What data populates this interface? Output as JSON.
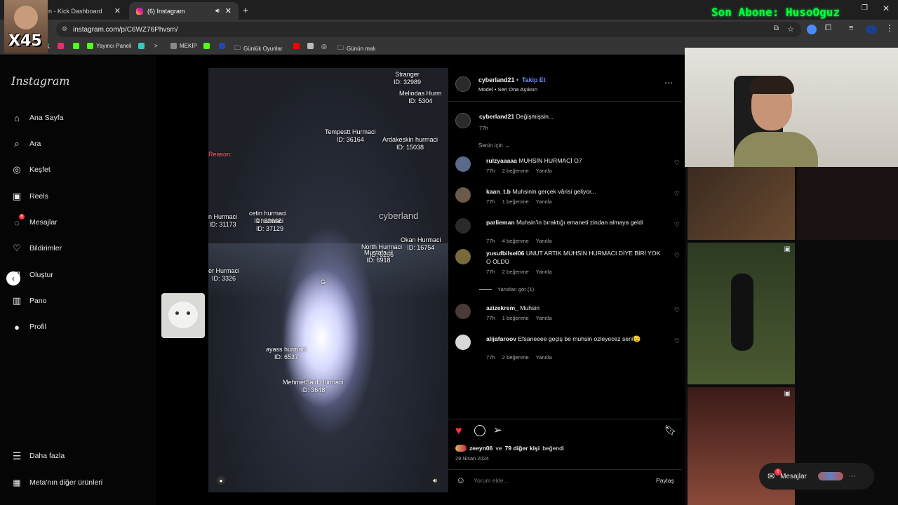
{
  "browser": {
    "tabs": [
      {
        "title": "n - Kick Dashboard"
      },
      {
        "title": "(6) Instagram"
      }
    ],
    "new_tab": "+",
    "url": "instagram.com/p/C6WZ76Phvsm/",
    "bookmarks": [
      "Yayıncı Paneli",
      "MEKİP",
      "Günlük Oyunlar",
      "Günün malı"
    ]
  },
  "stream_overlay": {
    "badge": "X45",
    "subscriber_banner": "Son Abone: HusoOguz"
  },
  "instagram": {
    "logo": "Instagram",
    "nav": [
      {
        "label": "Ana Sayfa",
        "icon": "home-icon"
      },
      {
        "label": "Ara",
        "icon": "search-icon"
      },
      {
        "label": "Keşfet",
        "icon": "explore-icon"
      },
      {
        "label": "Reels",
        "icon": "reels-icon"
      },
      {
        "label": "Mesajlar",
        "icon": "messages-icon",
        "badge": "6"
      },
      {
        "label": "Bildirimler",
        "icon": "heart-icon"
      },
      {
        "label": "Oluştur",
        "icon": "create-icon"
      },
      {
        "label": "Pano",
        "icon": "dashboard-icon"
      },
      {
        "label": "Profil",
        "icon": "profile-icon"
      }
    ],
    "more": "Daha fazla",
    "meta": "Meta'nın diğer ürünleri"
  },
  "post": {
    "author": "cyberland21",
    "follow": "Takip Et",
    "subtitle": "Model • Sen Ona Aşıksın",
    "caption_author": "cyberland21",
    "caption": "Değişmişsin...",
    "caption_time": "77h",
    "sort_label": "Senin için",
    "comments": [
      {
        "user": "rulzyaaaaa",
        "text": "MUHSİN HURMACİ O7",
        "time": "77h",
        "likes": "2 beğenme",
        "reply": "Yanıtla"
      },
      {
        "user": "kaan_t.b",
        "text": "Muhsinin gerçek vârisi geliyor...",
        "time": "77h",
        "likes": "1 beğenme",
        "reply": "Yanıtla"
      },
      {
        "user": "parlieman",
        "text": "Muhsin'in bıraktığı emaneti zindan almaya geldi",
        "time": "77h",
        "likes": "4 beğenme",
        "reply": "Yanıtla"
      },
      {
        "user": "yusufbilsel06",
        "text": "UNUT ARTIK MUHSİN HURMACI DİYE BİRİ YOK O ÖLDÜ",
        "time": "77h",
        "likes": "2 beğenme",
        "reply": "Yanıtla"
      },
      {
        "user": "azizekrem_",
        "text": "Muhsin",
        "time": "77h",
        "likes": "1 beğenme",
        "reply": "Yanıtla"
      },
      {
        "user": "alijafaroov",
        "text": "Efsaneeee geçiş be muhsin ozleyecez seni🫡",
        "time": "77h",
        "likes": "2 beğenme",
        "reply": "Yanıtla"
      }
    ],
    "view_replies": "Yanıtları gör (1)",
    "liked_by_user": "zeeyn06",
    "liked_by_joiner": "ve",
    "liked_by_others": "79 diğer kişi",
    "liked_by_suffix": "beğendi",
    "date": "29 Nisan 2024",
    "comment_placeholder": "Yorum ekle...",
    "share": "Paylaş"
  },
  "video_overlay_labels": [
    {
      "text": "Stranger\nID: 32989"
    },
    {
      "text": "Meliodas Hurm\nID: 5304"
    },
    {
      "text": "Tempestt Hurmaci\nID: 36164"
    },
    {
      "text": "Ardakeskin hurmaci\nID: 15038"
    },
    {
      "text": "Reason:"
    },
    {
      "text": "cetin hurmaci\nID: 32668"
    },
    {
      "text": "s hurmaci\nID: 37129"
    },
    {
      "text": "n Hurmaci\nID: 31173"
    },
    {
      "text": "cyberland"
    },
    {
      "text": "Okan Hurmaci\nID: 16754"
    },
    {
      "text": "North Hurmaci\nID: 6256"
    },
    {
      "text": "Mustafa H\nID: 6918"
    },
    {
      "text": "er Hurmaci\nID: 3326"
    },
    {
      "text": "G"
    },
    {
      "text": "ayass hurmaci\nID: 6537"
    },
    {
      "text": "MehmetSaid Hurmaci\nID: 3648"
    }
  ],
  "messages_widget": {
    "label": "Mesajlar",
    "badge": "6"
  },
  "colors": {
    "follow": "#708dff",
    "like": "#ff3040",
    "banner": "#00ff3c"
  }
}
